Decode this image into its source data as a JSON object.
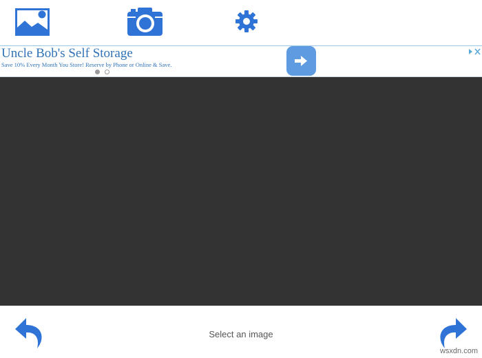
{
  "toolbar": {
    "items": [
      {
        "icon": "image-gallery-icon"
      },
      {
        "icon": "camera-icon"
      },
      {
        "icon": "gear-icon"
      }
    ]
  },
  "ad": {
    "title": "Uncle Bob's Self Storage",
    "description": "Save 10% Every Month You Store! Reserve by Phone or Online & Save.",
    "cta_icon": "arrow-right-icon",
    "slides_total": 2,
    "slide_active": 1
  },
  "canvas": {
    "background": "#333333"
  },
  "bottom": {
    "status_text": "Select an image",
    "back_icon": "undo-arrow-icon",
    "forward_icon": "redo-arrow-icon"
  },
  "watermark": "wsxdn.com",
  "colors": {
    "accent": "#2f73d6",
    "ad_text": "#2f73b8",
    "ad_button": "#5f9be0"
  }
}
